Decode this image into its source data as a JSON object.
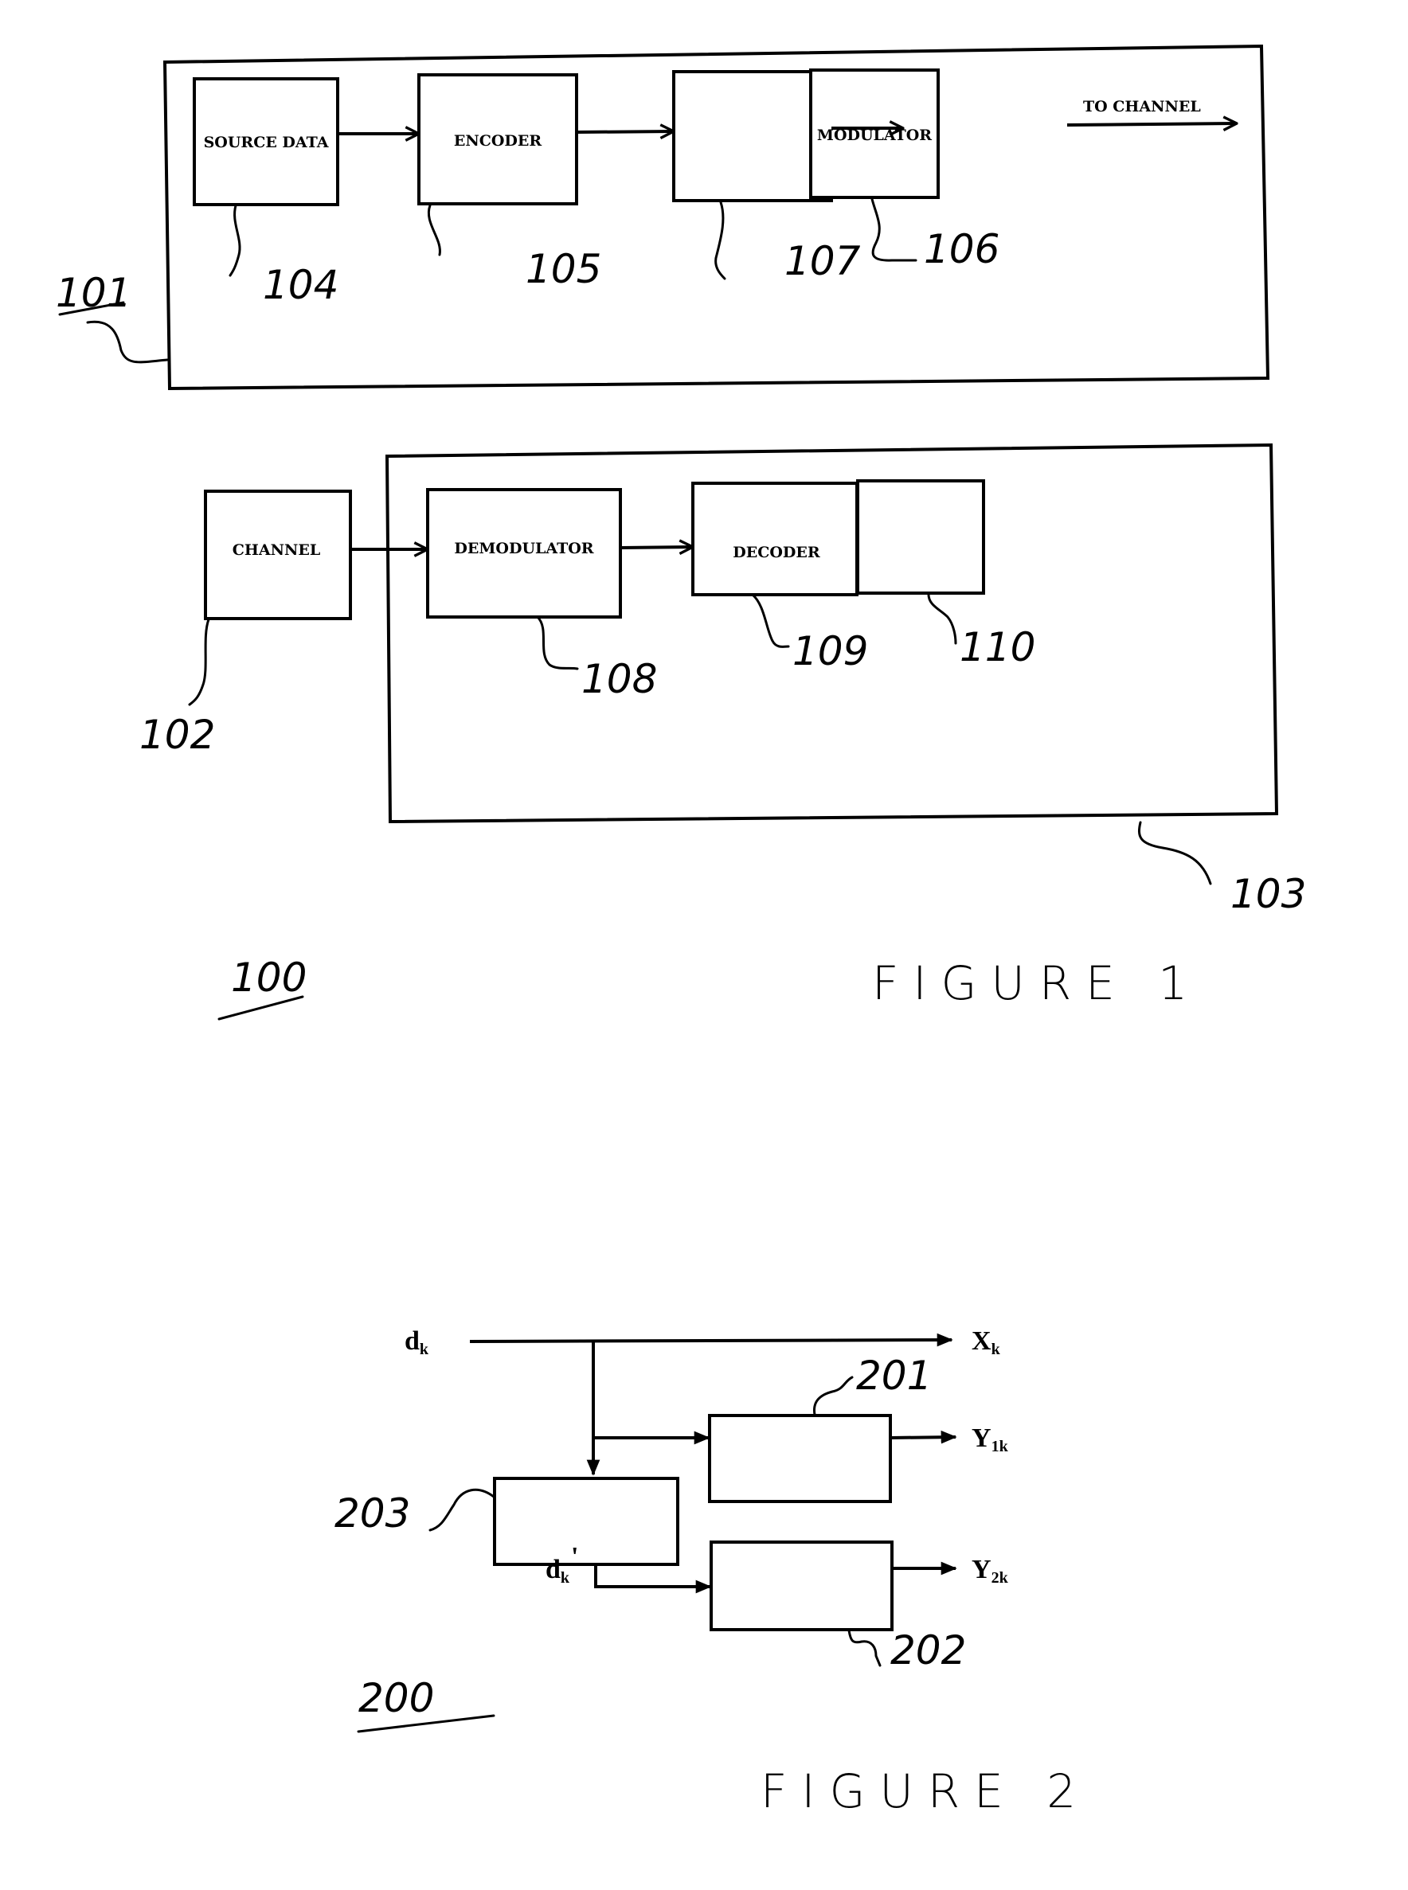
{
  "figure1": {
    "caption": "FIGURE 1",
    "ref": "100",
    "transmitter": {
      "ref": "101",
      "blocks": [
        {
          "ref": "104",
          "label": "SOURCE DATA"
        },
        {
          "ref": "105",
          "label": "ENCODER"
        },
        {
          "ref": "107",
          "label": ""
        },
        {
          "ref": "106",
          "label": "MODULATOR"
        }
      ],
      "output_label": "TO CHANNEL"
    },
    "channel": {
      "ref": "102",
      "label": "CHANNEL"
    },
    "receiver": {
      "ref": "103",
      "blocks": [
        {
          "ref": "108",
          "label": "DEMODULATOR"
        },
        {
          "ref": "109",
          "label": "DECODER"
        },
        {
          "ref": "110",
          "label": ""
        }
      ]
    }
  },
  "figure2": {
    "caption": "FIGURE 2",
    "ref": "200",
    "input": {
      "base": "d",
      "sub": "k"
    },
    "outputs": [
      {
        "base": "X",
        "sub": "k"
      },
      {
        "base": "Y",
        "sub": "1k"
      },
      {
        "base": "Y",
        "sub": "2k"
      }
    ],
    "interleaved": {
      "base": "d",
      "sub": "k",
      "prime": "'"
    },
    "blocks": [
      {
        "ref": "201",
        "label": ""
      },
      {
        "ref": "202",
        "label": ""
      },
      {
        "ref": "203",
        "label": ""
      }
    ]
  }
}
